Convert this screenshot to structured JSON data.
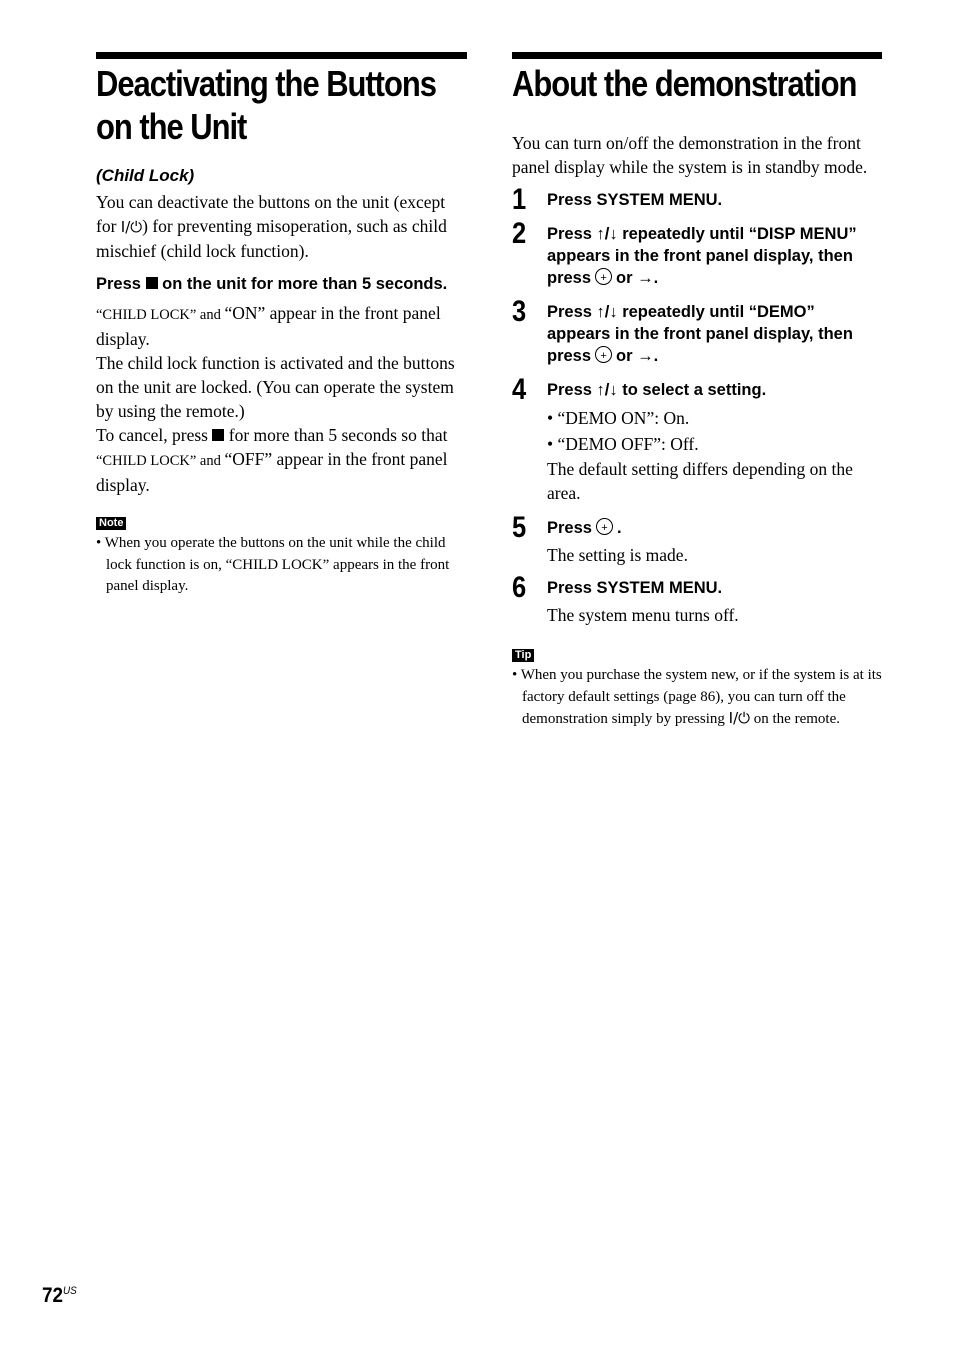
{
  "left": {
    "title_line1": "Deactivating the Buttons",
    "title_line2": "on the Unit",
    "subtitle": "(Child Lock)",
    "intro_a": "You can deactivate the buttons on the unit (except for ",
    "intro_power": "I/⏻",
    "intro_b": ") for preventing misoperation, such as child mischief (child lock function).",
    "instruction_a": "Press ",
    "instruction_b": " on the unit for more than 5 seconds.",
    "result_q1": "“CHILD LOCK”",
    "result_and1": " and ",
    "result_q2": "“ON”",
    "result_rest": " appear in the front panel display.",
    "para2": "The child lock function is activated and the buttons on the unit are locked. (You can operate the system by using the remote.)",
    "cancel_a": "To cancel, press ",
    "cancel_b": " for more than 5 seconds so that ",
    "cancel_q1": "“CHILD LOCK”",
    "cancel_and": " and ",
    "cancel_q2": "“OFF”",
    "cancel_rest": " appear in the front panel display.",
    "note_label": "Note",
    "note_text": "• When you operate the buttons on the unit while the child lock function is on, “CHILD LOCK” appears in the front panel display."
  },
  "right": {
    "title": "About the demonstration",
    "intro": "You can turn on/off the demonstration in the front panel display while the system is in standby mode.",
    "steps": [
      {
        "num": "1",
        "text": "Press SYSTEM MENU."
      },
      {
        "num": "2",
        "text_a": "Press ↑/↓ repeatedly until “DISP MENU” appears in the front panel display, then press",
        "text_b": "or →."
      },
      {
        "num": "3",
        "text_a": "Press ↑/↓ repeatedly until “DEMO” appears in the front panel display, then press",
        "text_b": "or →."
      },
      {
        "num": "4",
        "text": "Press ↑/↓ to select a setting.",
        "options": [
          "• “DEMO ON”: On.",
          "• “DEMO OFF”: Off."
        ],
        "desc": "The default setting differs depending on the area."
      },
      {
        "num": "5",
        "text_a": "Press",
        "text_b": ".",
        "desc": "The setting is made."
      },
      {
        "num": "6",
        "text": "Press SYSTEM MENU.",
        "desc": "The system menu turns off."
      }
    ],
    "tip_label": "Tip",
    "tip_a": "• When you purchase the system new, or if the system is at its factory default settings (page 86), you can turn off the demonstration simply by pressing ",
    "tip_power": "I/⏻",
    "tip_b": " on the remote."
  },
  "footer": {
    "page_number": "72",
    "page_suffix": "US"
  }
}
